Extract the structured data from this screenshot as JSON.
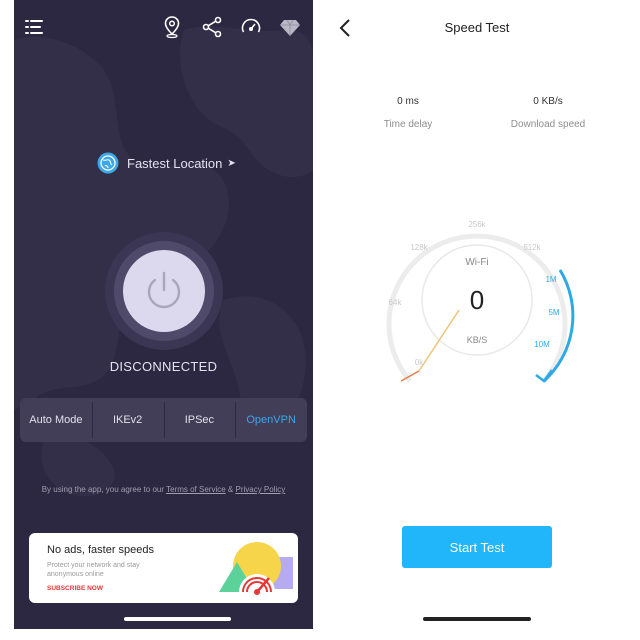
{
  "left_app": {
    "top_icons": [
      "menu-icon",
      "location-pin-icon",
      "share-icon",
      "speedometer-icon",
      "diamond-icon"
    ],
    "location": {
      "label": "Fastest Location",
      "arrow": "➤"
    },
    "status": "DISCONNECTED",
    "protocols": [
      {
        "label": "Auto Mode",
        "active": false
      },
      {
        "label": "IKEv2",
        "active": false
      },
      {
        "label": "IPSec",
        "active": false
      },
      {
        "label": "OpenVPN",
        "active": true
      }
    ],
    "terms": {
      "prefix": "By using the app, you agree to our",
      "tos": "Terms of Service",
      "amp": "&",
      "privacy": "Privacy Policy"
    },
    "ad": {
      "title": "No ads, faster speeds",
      "subtitle": "Protect your network and stay anonymous online",
      "cta": "SUBSCRIBE NOW"
    }
  },
  "right_app": {
    "title": "Speed Test",
    "time_delay": {
      "value": "0 ms",
      "label": "Time delay"
    },
    "download": {
      "value": "0 KB/s",
      "label": "Download speed"
    },
    "gauge": {
      "network": "Wi-Fi",
      "value": "0",
      "unit": "KB/S",
      "ticks": [
        "0k",
        "64k",
        "128k",
        "256k",
        "512k",
        "1M",
        "5M",
        "10M"
      ]
    },
    "start_button": "Start Test"
  },
  "colors": {
    "vpn_background": "#2c2841",
    "accent_blue": "#38a8ec",
    "start_button": "#20b6f9",
    "ad_cta": "#e53935"
  }
}
